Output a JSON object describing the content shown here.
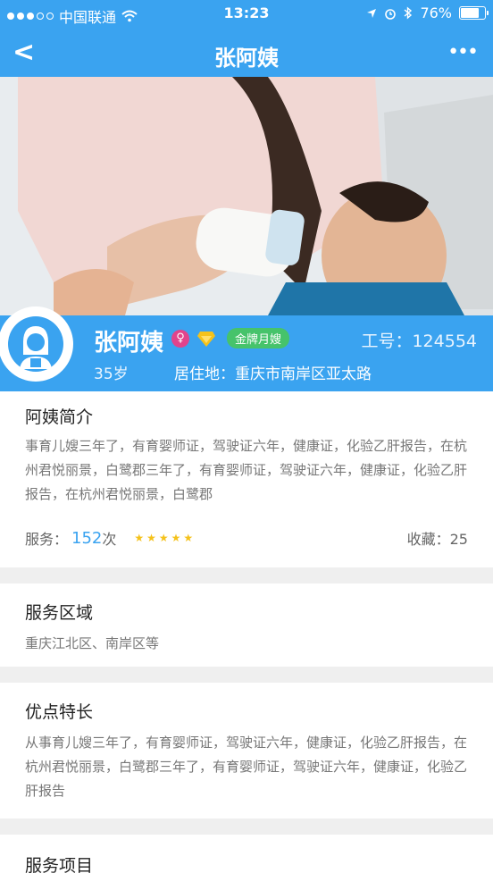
{
  "status": {
    "carrier": "中国联通",
    "time": "13:23",
    "battery": "76%"
  },
  "nav": {
    "back": "<",
    "title": "张阿姨",
    "more": "•••"
  },
  "profile": {
    "name": "张阿姨",
    "gender_symbol": "♀",
    "badge": "金牌月嫂",
    "job_no": "工号：124554",
    "age": "35岁",
    "location": "居住地：重庆市南岸区亚太路"
  },
  "intro": {
    "title": "阿姨简介",
    "text": "事育儿嫂三年了，有育婴师证，驾驶证六年，健康证，化验乙肝报告，在杭州君悦丽景，白鹭郡三年了，有育婴师证，驾驶证六年，健康证，化验乙肝报告，在杭州君悦丽景，白鹭郡",
    "service_label": "服务：",
    "service_count": "152",
    "service_unit": "次",
    "stars": "★★★★★",
    "favorites": "收藏：25"
  },
  "service_area": {
    "title": "服务区域",
    "text": "重庆江北区、南岸区等"
  },
  "strengths": {
    "title": "优点特长",
    "text": "从事育儿嫂三年了，有育婴师证，驾驶证六年，健康证，化验乙肝报告，在杭州君悦丽景，白鹭郡三年了，有育婴师证，驾驶证六年，健康证，化验乙肝报告"
  },
  "service_items": {
    "title": "服务项目"
  },
  "colors": {
    "primary": "#3aa3f0",
    "badge": "#46c36b",
    "star": "#f5c21b"
  }
}
